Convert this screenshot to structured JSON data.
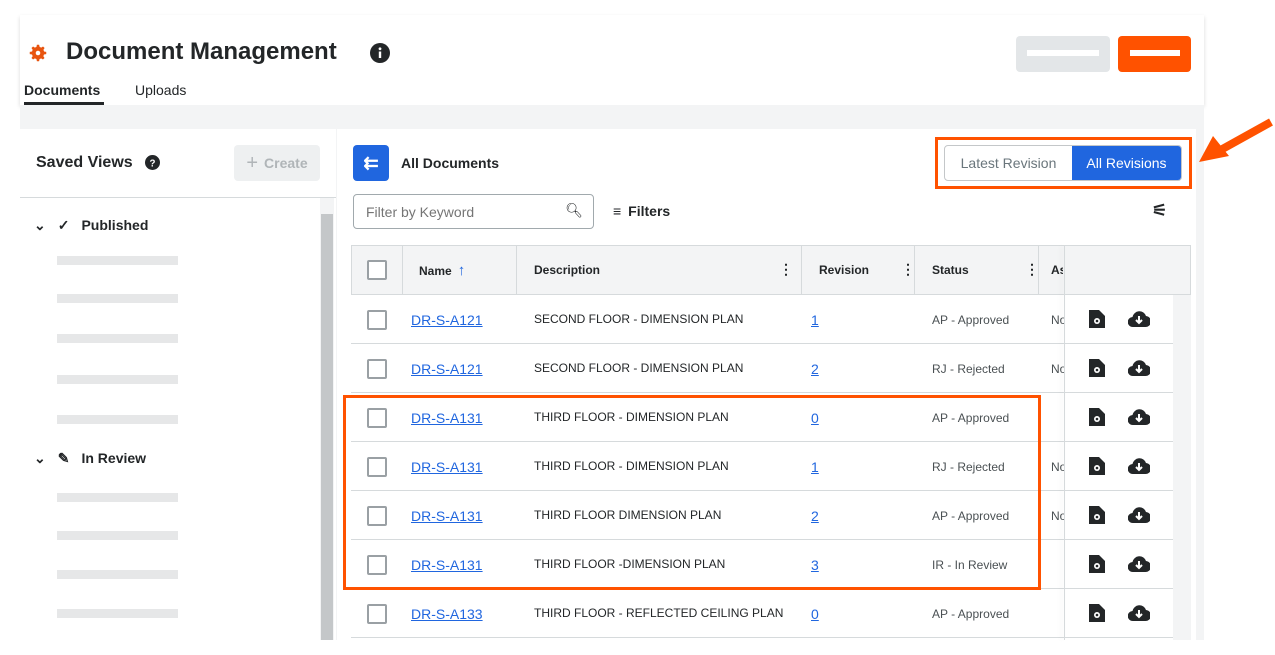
{
  "header": {
    "title": "Document Management",
    "tabs": [
      "Documents",
      "Uploads"
    ],
    "active_tab": "Documents"
  },
  "saved_views": {
    "title": "Saved Views",
    "create_label": "Create",
    "groups": [
      {
        "label": "Published",
        "icon": "check-icon"
      },
      {
        "label": "In Review",
        "icon": "pen-icon"
      }
    ]
  },
  "main": {
    "title": "All Documents",
    "toggle": [
      "Latest Revision",
      "All Revisions"
    ],
    "active_toggle": "All Revisions",
    "filter_placeholder": "Filter by Keyword",
    "filters_label": "Filters"
  },
  "table": {
    "columns": [
      "Name",
      "Description",
      "Revision",
      "Status",
      "As"
    ],
    "rows": [
      {
        "name": "DR-S-A121",
        "description": "SECOND FLOOR - DIMENSION PLAN",
        "revision": "1",
        "status": "AP - Approved",
        "assignee": "No"
      },
      {
        "name": "DR-S-A121",
        "description": "SECOND FLOOR - DIMENSION PLAN",
        "revision": "2",
        "status": "RJ - Rejected",
        "assignee": "No"
      },
      {
        "name": "DR-S-A131",
        "description": "THIRD FLOOR - DIMENSION PLAN",
        "revision": "0",
        "status": "AP - Approved",
        "assignee": ""
      },
      {
        "name": "DR-S-A131",
        "description": "THIRD FLOOR - DIMENSION PLAN",
        "revision": "1",
        "status": "RJ - Rejected",
        "assignee": "No"
      },
      {
        "name": "DR-S-A131",
        "description": "THIRD FLOOR DIMENSION PLAN",
        "revision": "2",
        "status": "AP - Approved",
        "assignee": "No"
      },
      {
        "name": "DR-S-A131",
        "description": "THIRD FLOOR -DIMENSION PLAN",
        "revision": "3",
        "status": "IR - In Review",
        "assignee": ""
      },
      {
        "name": "DR-S-A133",
        "description": "THIRD FLOOR - REFLECTED CEILING PLAN",
        "revision": "0",
        "status": "AP - Approved",
        "assignee": ""
      }
    ]
  },
  "colors": {
    "brand": "#ff5200",
    "primary": "#2066df",
    "annotation": "#ff5200"
  }
}
